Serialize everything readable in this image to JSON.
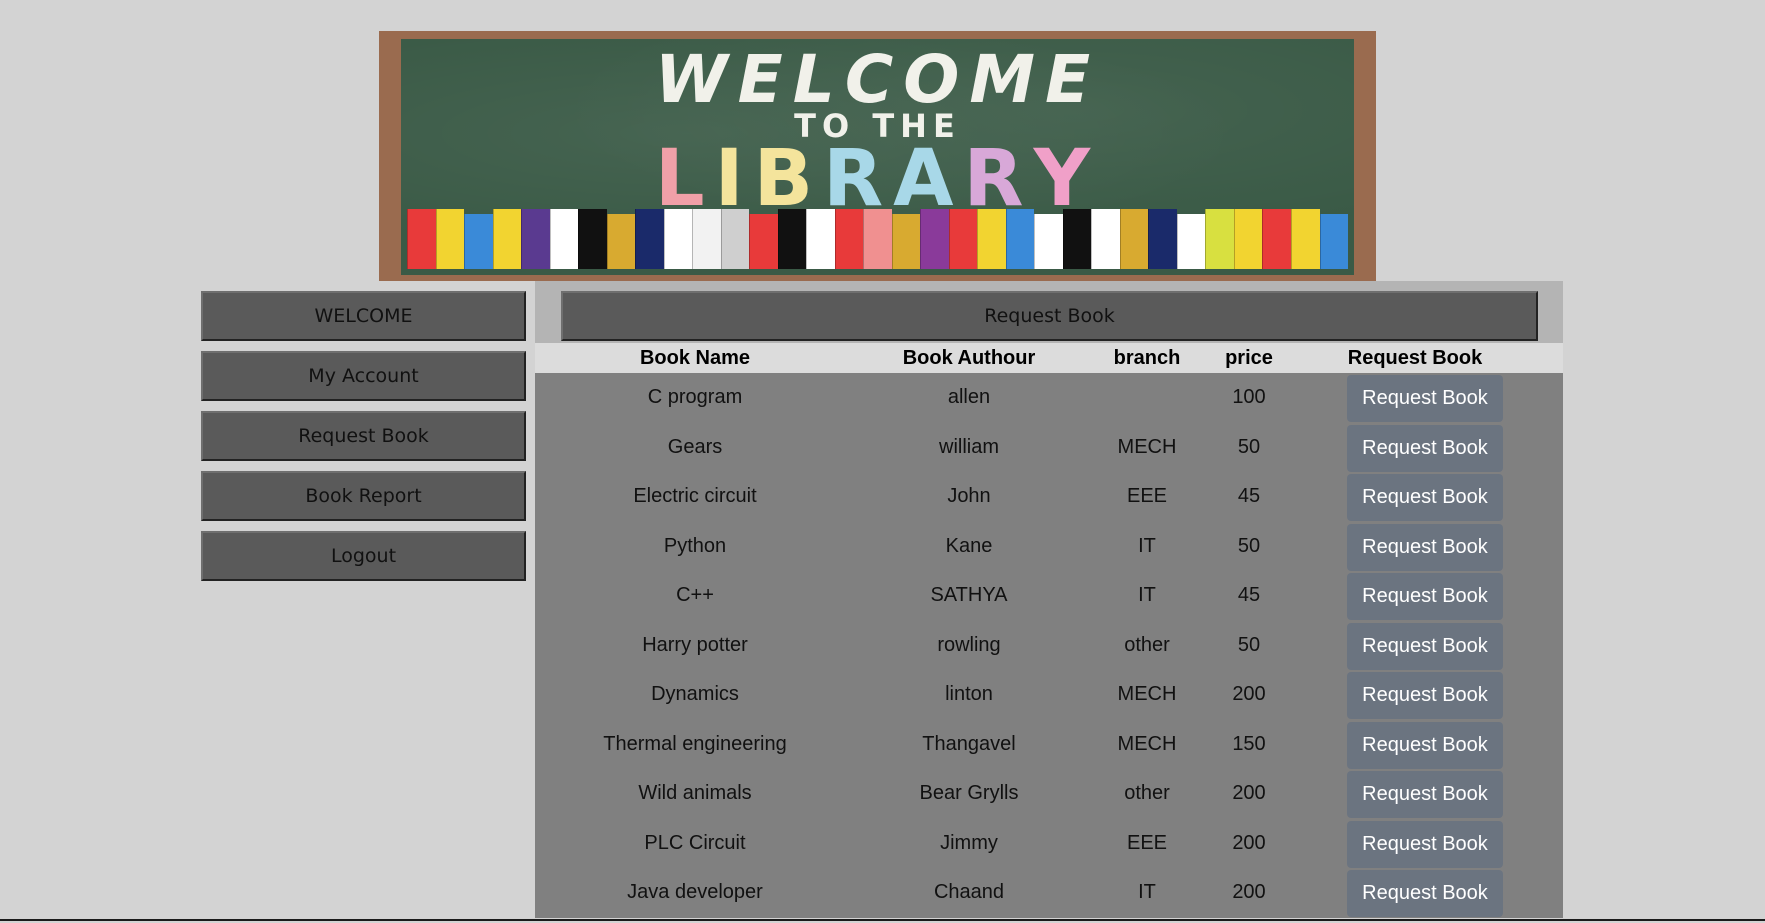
{
  "banner": {
    "line1": "WELCOME",
    "line2": "TO THE",
    "line3_letters": [
      {
        "ch": "L",
        "color": "#f0a0a8"
      },
      {
        "ch": "I",
        "color": "#f4e49c"
      },
      {
        "ch": "B",
        "color": "#f4e49c"
      },
      {
        "ch": "R",
        "color": "#a8d8e8"
      },
      {
        "ch": "A",
        "color": "#a8d8e8"
      },
      {
        "ch": "R",
        "color": "#d8a8d8"
      },
      {
        "ch": "Y",
        "color": "#f0a0c8"
      }
    ],
    "book_colors": [
      "#e83a3a",
      "#f2d430",
      "#3a8ad8",
      "#f2d430",
      "#5a3a90",
      "#ffffff",
      "#111111",
      "#d8aa30",
      "#1a2a6a",
      "#ffffff",
      "#f2f2f2",
      "#cfcfcf",
      "#e83a3a",
      "#111111",
      "#ffffff",
      "#e83a3a",
      "#f09090",
      "#d8aa30",
      "#8a3a9a",
      "#e83a3a",
      "#f2d430",
      "#3a8ad8",
      "#ffffff",
      "#111111",
      "#ffffff",
      "#d8aa30",
      "#1a2a6a",
      "#ffffff",
      "#d8e040",
      "#f2d430",
      "#e83a3a",
      "#f2d430",
      "#3a8ad8"
    ]
  },
  "sidebar": {
    "items": [
      {
        "label": "WELCOME"
      },
      {
        "label": "My Account"
      },
      {
        "label": "Request Book"
      },
      {
        "label": "Book Report"
      },
      {
        "label": "Logout"
      }
    ]
  },
  "main": {
    "title": "Request Book",
    "columns": {
      "name": "Book Name",
      "author": "Book Authour",
      "branch": "branch",
      "price": "price",
      "request": "Request Book"
    },
    "rows": [
      {
        "name": "C program",
        "author": "allen",
        "branch": "",
        "price": "100",
        "action": "Request Book"
      },
      {
        "name": "Gears",
        "author": "william",
        "branch": "MECH",
        "price": "50",
        "action": "Request Book"
      },
      {
        "name": "Electric circuit",
        "author": "John",
        "branch": "EEE",
        "price": "45",
        "action": "Request Book"
      },
      {
        "name": "Python",
        "author": "Kane",
        "branch": "IT",
        "price": "50",
        "action": "Request Book"
      },
      {
        "name": "C++",
        "author": "SATHYA",
        "branch": "IT",
        "price": "45",
        "action": "Request Book"
      },
      {
        "name": "Harry potter",
        "author": "rowling",
        "branch": "other",
        "price": "50",
        "action": "Request Book"
      },
      {
        "name": "Dynamics",
        "author": "linton",
        "branch": "MECH",
        "price": "200",
        "action": "Request Book"
      },
      {
        "name": "Thermal engineering",
        "author": "Thangavel",
        "branch": "MECH",
        "price": "150",
        "action": "Request Book"
      },
      {
        "name": "Wild animals",
        "author": "Bear Grylls",
        "branch": "other",
        "price": "200",
        "action": "Request Book"
      },
      {
        "name": "PLC Circuit",
        "author": "Jimmy",
        "branch": "EEE",
        "price": "200",
        "action": "Request Book"
      },
      {
        "name": "Java developer",
        "author": "Chaand",
        "branch": "IT",
        "price": "200",
        "action": "Request Book"
      }
    ]
  }
}
